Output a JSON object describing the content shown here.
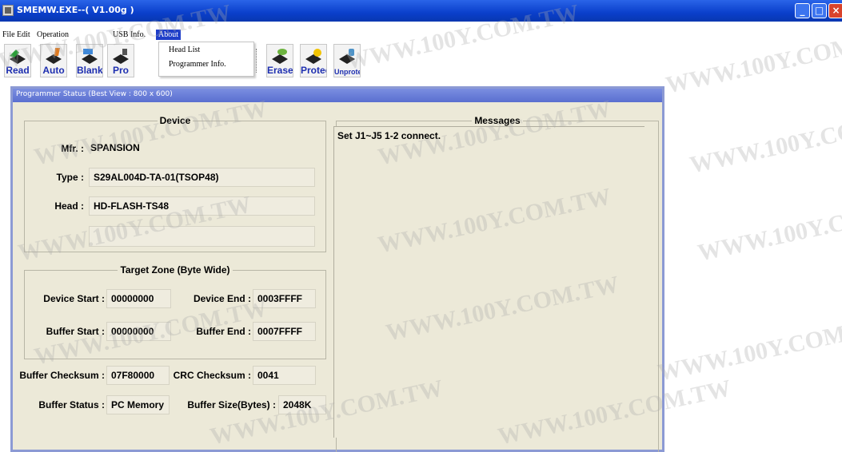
{
  "window": {
    "title": "SMEMW.EXE--( V1.00g )",
    "controls": {
      "minimize": "_",
      "maximize": "□",
      "close": "×"
    }
  },
  "menu": [
    "File",
    "Edit",
    "Operation",
    "USB Info.",
    "About"
  ],
  "toolbar": {
    "read": "Read",
    "auto": "Auto",
    "blank": "Blank",
    "pro": "Pro",
    "erase": "Erase",
    "protect": "Protect",
    "unprotect": "Unprotect"
  },
  "about_menu": {
    "items": [
      "Head List",
      "Programmer Info."
    ]
  },
  "status_window": {
    "title": "Programmer Status  (Best View : 800 x 600)",
    "device": {
      "heading": "Device",
      "mfr_label": "Mfr. :",
      "mfr_value": "SPANSION",
      "type_label": "Type :",
      "type_value": "S29AL004D-TA-01(TSOP48)",
      "head_label": "Head :",
      "head_value": "HD-FLASH-TS48",
      "extra_value": ""
    },
    "target_zone": {
      "heading": "Target Zone (Byte Wide)",
      "device_start_label": "Device Start :",
      "device_start": "00000000",
      "device_end_label": "Device End :",
      "device_end": "0003FFFF",
      "buffer_start_label": "Buffer Start :",
      "buffer_start": "00000000",
      "buffer_end_label": "Buffer End :",
      "buffer_end": "0007FFFF"
    },
    "buffer_checksum_label": "Buffer Checksum :",
    "buffer_checksum": "07F80000",
    "crc_checksum_label": "CRC Checksum :",
    "crc_checksum": "0041",
    "buffer_status_label": "Buffer Status :",
    "buffer_status": "PC Memory",
    "buffer_size_label": "Buffer Size(Bytes) :",
    "buffer_size": "2048K",
    "messages": {
      "heading": "Messages",
      "text": "Set J1~J5 1-2 connect."
    }
  },
  "watermark": "WWW.100Y.COM.TW"
}
